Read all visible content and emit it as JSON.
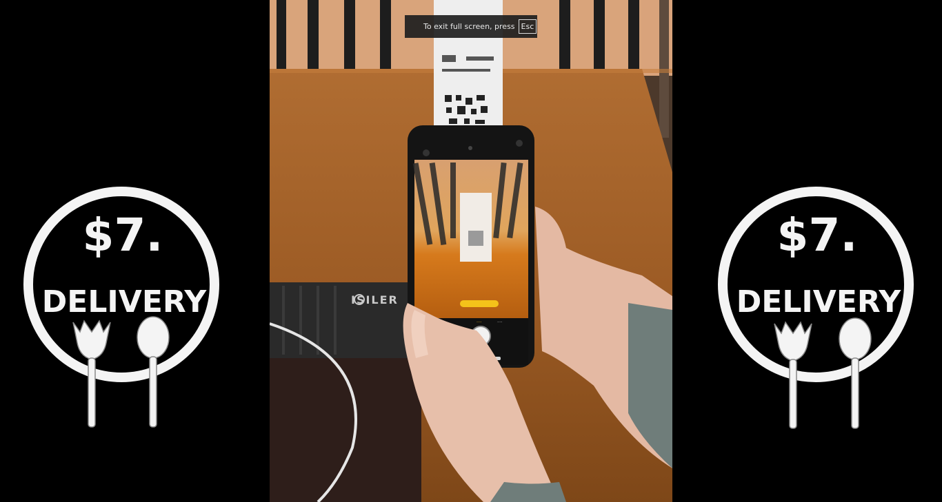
{
  "fullscreen_toast": {
    "message": "To exit full screen, press",
    "key": "Esc"
  },
  "logo": {
    "price": "$7.",
    "word": "DELIVERY",
    "icons": [
      "spork-icon",
      "spoon-icon"
    ]
  },
  "video": {
    "brand": "ISILER"
  },
  "colors": {
    "background": "#000000",
    "table": "#a0622a",
    "logo": "#f4f4f4"
  }
}
